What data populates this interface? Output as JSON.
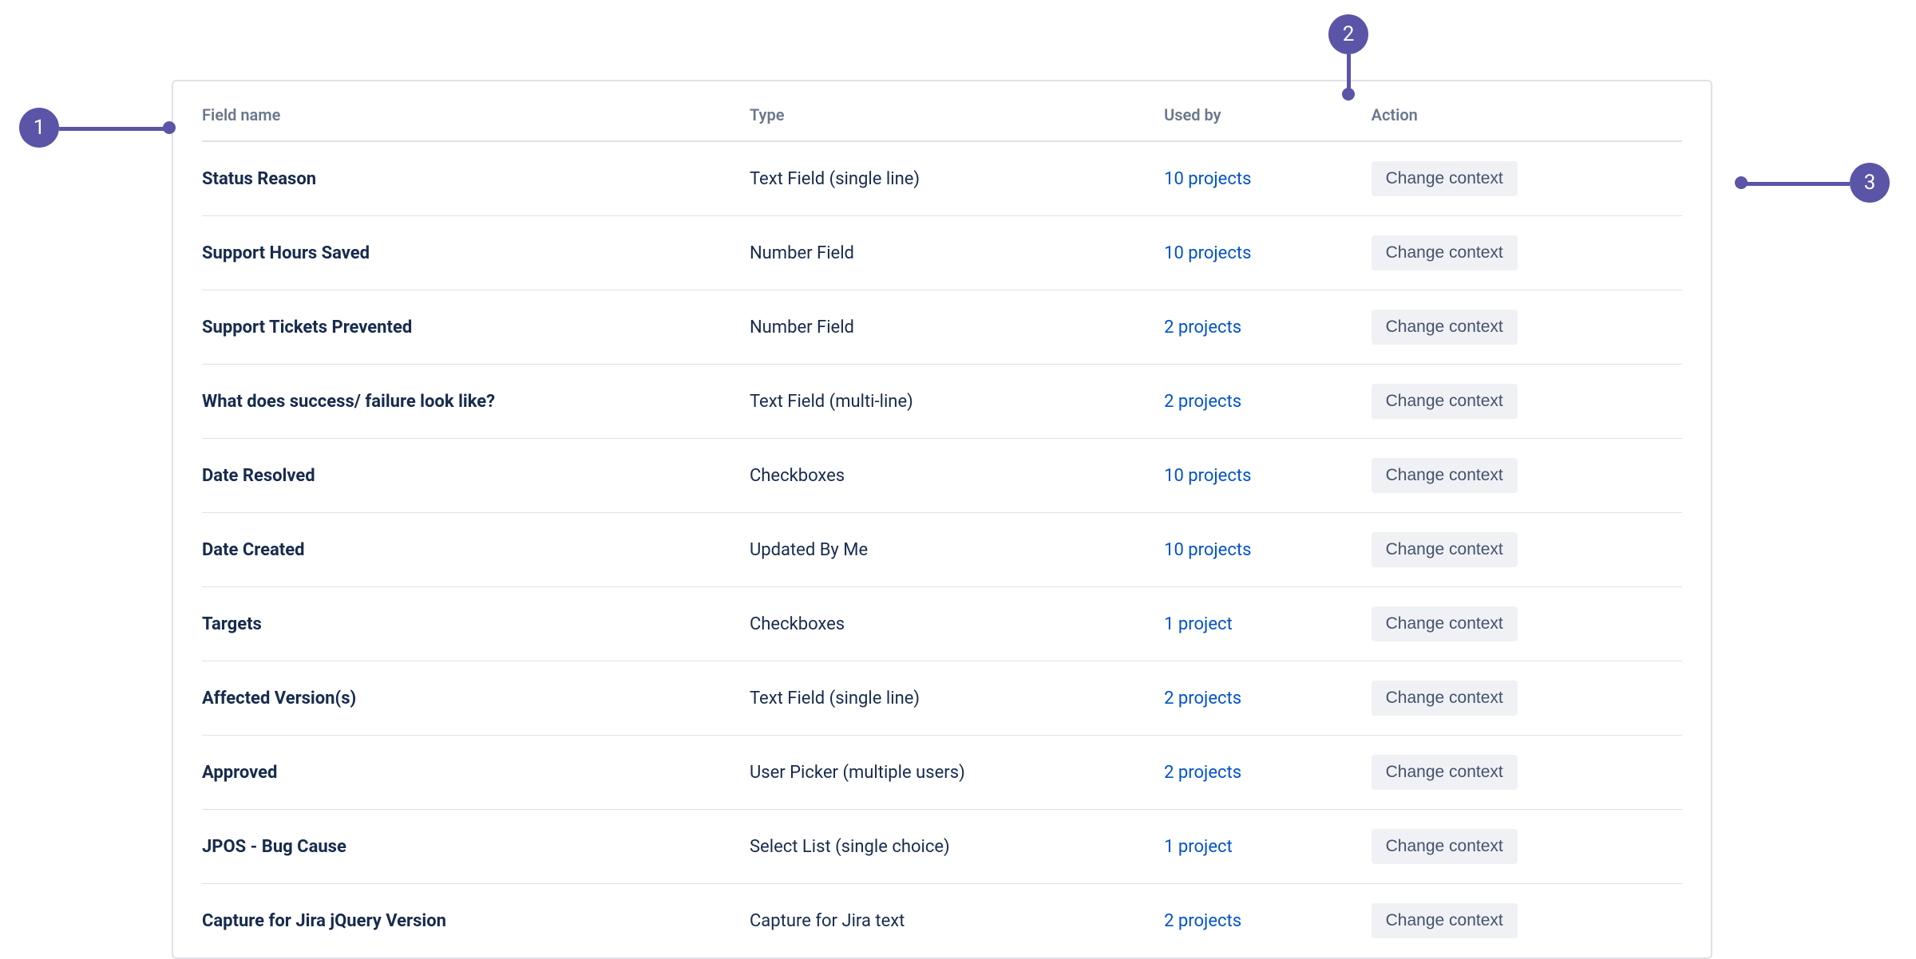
{
  "callouts": {
    "c1": "1",
    "c2": "2",
    "c3": "3"
  },
  "table": {
    "headers": {
      "name": "Field name",
      "type": "Type",
      "used_by": "Used by",
      "action": "Action"
    },
    "rows": [
      {
        "name": "Status Reason",
        "type": "Text Field (single line)",
        "used_by": "10 projects",
        "action": "Change context"
      },
      {
        "name": "Support Hours Saved",
        "type": "Number Field",
        "used_by": "10 projects",
        "action": "Change context"
      },
      {
        "name": "Support Tickets Prevented",
        "type": "Number Field",
        "used_by": "2 projects",
        "action": "Change context"
      },
      {
        "name": "What does success/ failure look like?",
        "type": "Text Field (multi-line)",
        "used_by": "2 projects",
        "action": "Change context"
      },
      {
        "name": "Date Resolved",
        "type": "Checkboxes",
        "used_by": "10 projects",
        "action": "Change context"
      },
      {
        "name": "Date Created",
        "type": "Updated By Me",
        "used_by": "10 projects",
        "action": "Change context"
      },
      {
        "name": "Targets",
        "type": "Checkboxes",
        "used_by": "1 project",
        "action": "Change context"
      },
      {
        "name": "Affected Version(s)",
        "type": "Text Field (single line)",
        "used_by": "2 projects",
        "action": "Change context"
      },
      {
        "name": "Approved",
        "type": "User Picker (multiple users)",
        "used_by": "2 projects",
        "action": "Change context"
      },
      {
        "name": "JPOS - Bug Cause",
        "type": "Select List (single choice)",
        "used_by": "1 project",
        "action": "Change context"
      },
      {
        "name": "Capture for Jira jQuery Version",
        "type": "Capture for Jira text",
        "used_by": "2 projects",
        "action": "Change context"
      }
    ]
  }
}
